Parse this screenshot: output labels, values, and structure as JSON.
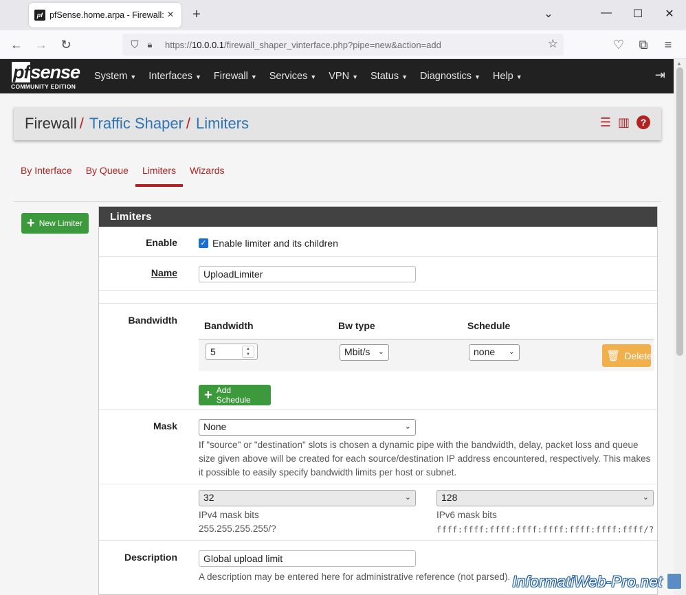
{
  "browser": {
    "tab_title": "pfSense.home.arpa - Firewall: Tr",
    "url_prefix": "https://",
    "url_host": "10.0.0.1",
    "url_path": "/firewall_shaper_vinterface.php?pipe=new&action=add"
  },
  "header": {
    "brand": "sense",
    "brand_pf": "pf",
    "edition": "COMMUNITY EDITION",
    "menu": [
      "System",
      "Interfaces",
      "Firewall",
      "Services",
      "VPN",
      "Status",
      "Diagnostics",
      "Help"
    ]
  },
  "breadcrumb": {
    "root": "Firewall",
    "section": "Traffic Shaper",
    "page": "Limiters",
    "sep": "/"
  },
  "tabs": [
    "By Interface",
    "By Queue",
    "Limiters",
    "Wizards"
  ],
  "active_tab": "Limiters",
  "sidebar": {
    "new_limiter": "New Limiter"
  },
  "panel": {
    "title": "Limiters",
    "enable": {
      "label": "Enable",
      "checkbox_label": "Enable limiter and its children",
      "checked": true
    },
    "name": {
      "label": "Name",
      "value": "UploadLimiter"
    },
    "bandwidth": {
      "label": "Bandwidth",
      "col_bandwidth": "Bandwidth",
      "col_bwtype": "Bw type",
      "col_schedule": "Schedule",
      "value": "5",
      "bwtype": "Mbit/s",
      "schedule": "none",
      "delete": "Delete",
      "add_schedule": "Add Schedule"
    },
    "mask": {
      "label": "Mask",
      "value": "None",
      "help": "If \"source\" or \"destination\" slots is chosen a dynamic pipe with the bandwidth, delay, packet loss and queue size given above will be created for each source/destination IP address encountered, respectively. This makes it possible to easily specify bandwidth limits per host or subnet.",
      "ipv4_bits": "32",
      "ipv4_label": "IPv4 mask bits",
      "ipv4_hint": "255.255.255.255/?",
      "ipv6_bits": "128",
      "ipv6_label": "IPv6 mask bits",
      "ipv6_hint": "ffff:ffff:ffff:ffff:ffff:ffff:ffff:ffff/?"
    },
    "description": {
      "label": "Description",
      "value": "Global upload limit",
      "help": "A description may be entered here for administrative reference (not parsed)."
    }
  },
  "watermark": "InformatiWeb-Pro.net",
  "colors": {
    "accent": "#b22222",
    "link": "#2f75b4",
    "success": "#3c9a3c",
    "warning": "#f2b04c",
    "header": "#212121"
  }
}
